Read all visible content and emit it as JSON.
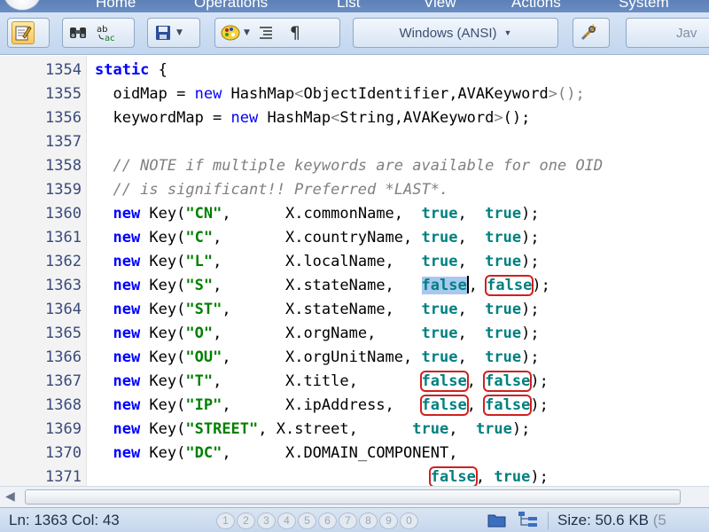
{
  "ribbon": {
    "tabs": [
      "Home",
      "Operations",
      "List",
      "View",
      "Actions",
      "System"
    ]
  },
  "toolbar": {
    "encoding_label": "Windows (ANSI)",
    "language_label": "Jav"
  },
  "editor": {
    "lines": [
      {
        "n": "1354",
        "tokens": [
          [
            "kw",
            "static"
          ],
          [
            "op",
            " {"
          ]
        ]
      },
      {
        "n": "1355",
        "tokens": [
          [
            "op",
            "  oidMap = "
          ],
          [
            "kw2",
            "new"
          ],
          [
            "op",
            " HashMap"
          ],
          [
            "gen",
            "<"
          ],
          [
            "op",
            "ObjectIdentifier,AVAKeyword"
          ],
          [
            "gen",
            ">();"
          ]
        ]
      },
      {
        "n": "1356",
        "tokens": [
          [
            "op",
            "  keywordMap = "
          ],
          [
            "kw2",
            "new"
          ],
          [
            "op",
            " HashMap"
          ],
          [
            "gen",
            "<"
          ],
          [
            "op",
            "String,AVAKeyword"
          ],
          [
            "gen",
            ">"
          ],
          [
            "op",
            "();"
          ]
        ]
      },
      {
        "n": "1357",
        "tokens": []
      },
      {
        "n": "1358",
        "tokens": [
          [
            "cm",
            "  // NOTE if multiple keywords are available for one OID"
          ]
        ]
      },
      {
        "n": "1359",
        "tokens": [
          [
            "cm",
            "  // is significant!! Preferred *LAST*."
          ]
        ]
      },
      {
        "n": "1360",
        "tokens": [
          [
            "kw",
            "  new"
          ],
          [
            "op",
            " Key("
          ],
          [
            "str",
            "\"CN\""
          ],
          [
            "op",
            ",      X.commonName,  "
          ],
          [
            "bool",
            "true"
          ],
          [
            "op",
            ",  "
          ],
          [
            "bool",
            "true"
          ],
          [
            "op",
            ");"
          ]
        ]
      },
      {
        "n": "1361",
        "tokens": [
          [
            "kw",
            "  new"
          ],
          [
            "op",
            " Key("
          ],
          [
            "str",
            "\"C\""
          ],
          [
            "op",
            ",       X.countryName, "
          ],
          [
            "bool",
            "true"
          ],
          [
            "op",
            ",  "
          ],
          [
            "bool",
            "true"
          ],
          [
            "op",
            ");"
          ]
        ]
      },
      {
        "n": "1362",
        "tokens": [
          [
            "kw",
            "  new"
          ],
          [
            "op",
            " Key("
          ],
          [
            "str",
            "\"L\""
          ],
          [
            "op",
            ",       X.localName,   "
          ],
          [
            "bool",
            "true"
          ],
          [
            "op",
            ",  "
          ],
          [
            "bool",
            "true"
          ],
          [
            "op",
            ");"
          ]
        ]
      },
      {
        "n": "1363",
        "tokens": [
          [
            "kw",
            "  new"
          ],
          [
            "op",
            " Key("
          ],
          [
            "str",
            "\"S\""
          ],
          [
            "op",
            ",       X.stateName,   "
          ],
          [
            "boolsel",
            "false"
          ],
          [
            "caret",
            ""
          ],
          [
            "op",
            ", "
          ],
          [
            "boolmark",
            "false"
          ],
          [
            "op",
            ");"
          ]
        ]
      },
      {
        "n": "1364",
        "tokens": [
          [
            "kw",
            "  new"
          ],
          [
            "op",
            " Key("
          ],
          [
            "str",
            "\"ST\""
          ],
          [
            "op",
            ",      X.stateName,   "
          ],
          [
            "bool",
            "true"
          ],
          [
            "op",
            ",  "
          ],
          [
            "bool",
            "true"
          ],
          [
            "op",
            ");"
          ]
        ]
      },
      {
        "n": "1365",
        "tokens": [
          [
            "kw",
            "  new"
          ],
          [
            "op",
            " Key("
          ],
          [
            "str",
            "\"O\""
          ],
          [
            "op",
            ",       X.orgName,     "
          ],
          [
            "bool",
            "true"
          ],
          [
            "op",
            ",  "
          ],
          [
            "bool",
            "true"
          ],
          [
            "op",
            ");"
          ]
        ]
      },
      {
        "n": "1366",
        "tokens": [
          [
            "kw",
            "  new"
          ],
          [
            "op",
            " Key("
          ],
          [
            "str",
            "\"OU\""
          ],
          [
            "op",
            ",      X.orgUnitName, "
          ],
          [
            "bool",
            "true"
          ],
          [
            "op",
            ",  "
          ],
          [
            "bool",
            "true"
          ],
          [
            "op",
            ");"
          ]
        ]
      },
      {
        "n": "1367",
        "tokens": [
          [
            "kw",
            "  new"
          ],
          [
            "op",
            " Key("
          ],
          [
            "str",
            "\"T\""
          ],
          [
            "op",
            ",       X.title,       "
          ],
          [
            "boolmark",
            "false"
          ],
          [
            "op",
            ", "
          ],
          [
            "boolmark",
            "false"
          ],
          [
            "op",
            ");"
          ]
        ]
      },
      {
        "n": "1368",
        "tokens": [
          [
            "kw",
            "  new"
          ],
          [
            "op",
            " Key("
          ],
          [
            "str",
            "\"IP\""
          ],
          [
            "op",
            ",      X.ipAddress,   "
          ],
          [
            "boolmark",
            "false"
          ],
          [
            "op",
            ", "
          ],
          [
            "boolmark",
            "false"
          ],
          [
            "op",
            ");"
          ]
        ]
      },
      {
        "n": "1369",
        "tokens": [
          [
            "kw",
            "  new"
          ],
          [
            "op",
            " Key("
          ],
          [
            "str",
            "\"STREET\""
          ],
          [
            "op",
            ", X.street,      "
          ],
          [
            "bool",
            "true"
          ],
          [
            "op",
            ",  "
          ],
          [
            "bool",
            "true"
          ],
          [
            "op",
            ");"
          ]
        ]
      },
      {
        "n": "1370",
        "tokens": [
          [
            "kw",
            "  new"
          ],
          [
            "op",
            " Key("
          ],
          [
            "str",
            "\"DC\""
          ],
          [
            "op",
            ",      X.DOMAIN_COMPONENT,"
          ]
        ]
      },
      {
        "n": "1371",
        "tokens": [
          [
            "op",
            "                                     "
          ],
          [
            "boolmark",
            "false"
          ],
          [
            "op",
            ", "
          ],
          [
            "bool",
            "true"
          ],
          [
            "op",
            ");"
          ]
        ]
      }
    ]
  },
  "statusbar": {
    "line_col": "Ln: 1363   Col: 43",
    "bookmarks": [
      "1",
      "2",
      "3",
      "4",
      "5",
      "6",
      "7",
      "8",
      "9",
      "0"
    ],
    "size_label": "Size: 50.6 KB",
    "size_extra": "(5"
  },
  "colors": {
    "keyword": "#0000ff",
    "string": "#008000",
    "boolean": "#008080",
    "comment": "#808080",
    "mark_outline": "#d02020",
    "selection": "#a8c8f0"
  }
}
